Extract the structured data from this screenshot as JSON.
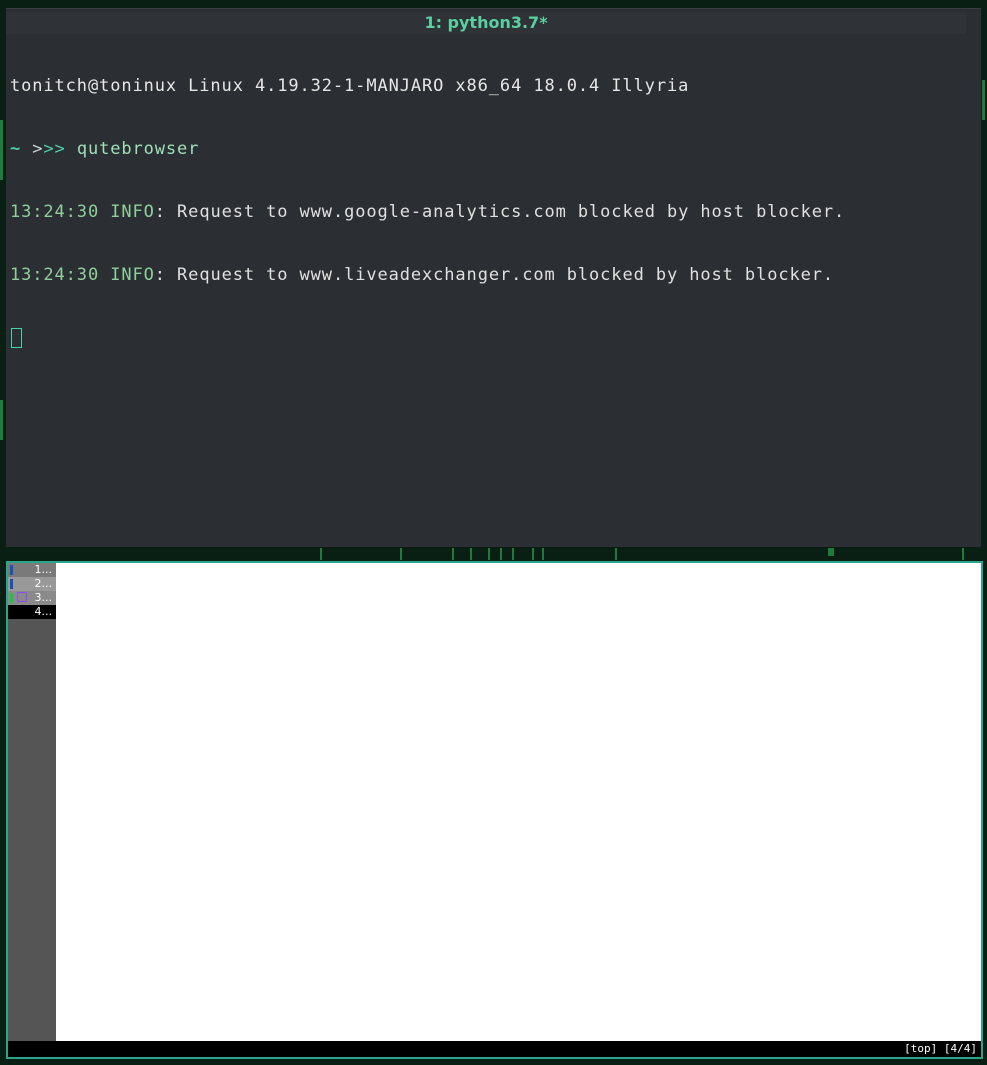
{
  "terminal": {
    "title": "1: python3.7*",
    "system_line": "tonitch@toninux Linux 4.19.32-1-MANJARO x86_64 18.0.4 Illyria",
    "prompt": {
      "tilde": "~",
      "arrow_dim": " >",
      "arrow_bright": ">>",
      "command": " qutebrowser"
    },
    "log_lines": [
      {
        "time": "13:24:30",
        "level": " INFO",
        "message": ": Request to www.google-analytics.com blocked by host blocker."
      },
      {
        "time": "13:24:30",
        "level": " INFO",
        "message": ": Request to www.liveadexchanger.com blocked by host blocker."
      }
    ]
  },
  "browser": {
    "tabs": [
      {
        "label": "1..."
      },
      {
        "label": "2..."
      },
      {
        "label": "3..."
      },
      {
        "label": "4..."
      }
    ],
    "status": "[top] [4/4]"
  },
  "colors": {
    "accent": "#2aa58a",
    "terminal_bg": "#2b2e33",
    "wallpaper": "#0a1f14"
  }
}
